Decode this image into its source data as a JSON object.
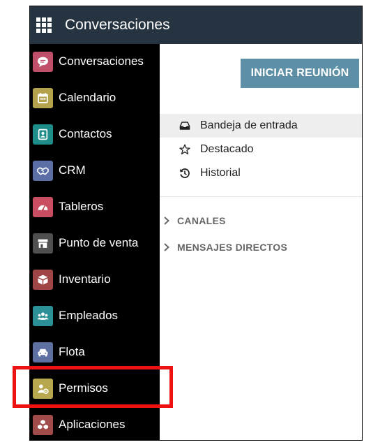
{
  "topbar": {
    "title": "Conversaciones",
    "apps_icon": "grid-icon"
  },
  "sidebar": {
    "items": [
      {
        "label": "Conversaciones",
        "icon": "chat-icon",
        "color": "#c0506a"
      },
      {
        "label": "Calendario",
        "icon": "calendar-icon",
        "color": "#b5a24c"
      },
      {
        "label": "Contactos",
        "icon": "contact-icon",
        "color": "#1f8d8a"
      },
      {
        "label": "CRM",
        "icon": "handshake-icon",
        "color": "#5b6fa6"
      },
      {
        "label": "Tableros",
        "icon": "dashboard-icon",
        "color": "#c94e62"
      },
      {
        "label": "Punto de venta",
        "icon": "store-icon",
        "color": "#4f4f4f"
      },
      {
        "label": "Inventario",
        "icon": "box-icon",
        "color": "#a04545"
      },
      {
        "label": "Empleados",
        "icon": "users-icon",
        "color": "#2b9196"
      },
      {
        "label": "Flota",
        "icon": "car-icon",
        "color": "#5e6fa2"
      },
      {
        "label": "Permisos",
        "icon": "user-gear-icon",
        "color": "#b7a74f"
      },
      {
        "label": "Aplicaciones",
        "icon": "cubes-icon",
        "color": "#a14b4b"
      }
    ]
  },
  "main": {
    "meeting_button": "INICIAR REUNIÓN",
    "mailboxes": [
      {
        "label": "Bandeja de entrada",
        "icon": "inbox-icon",
        "active": true
      },
      {
        "label": "Destacado",
        "icon": "star-icon",
        "active": false
      },
      {
        "label": "Historial",
        "icon": "history-icon",
        "active": false
      }
    ],
    "sections": [
      {
        "label": "CANALES"
      },
      {
        "label": "MENSAJES DIRECTOS"
      }
    ]
  },
  "colors": {
    "topbar": "#263340",
    "sidebar": "#000000",
    "button": "#5d8fa6",
    "highlight": "#ee1111"
  }
}
